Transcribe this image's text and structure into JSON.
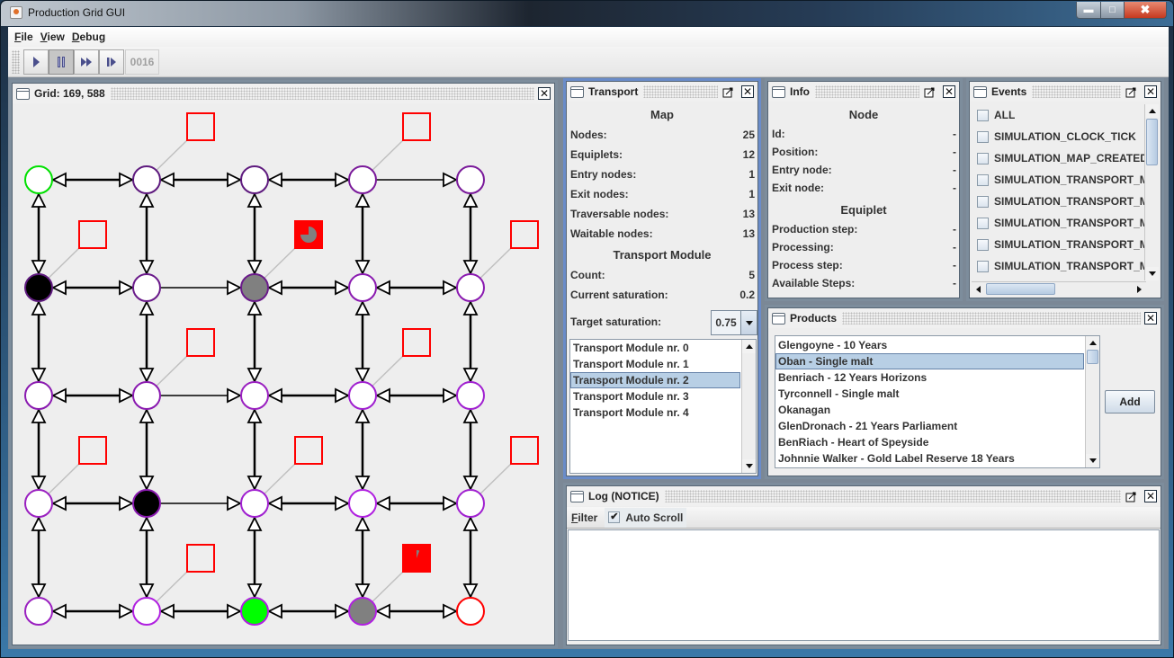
{
  "window": {
    "title": "Production Grid GUI",
    "controls": [
      "minimize",
      "maximize",
      "close"
    ]
  },
  "menubar": [
    {
      "label": "File",
      "mnemonic": "F",
      "rest": "ile"
    },
    {
      "label": "View",
      "mnemonic": "V",
      "rest": "iew"
    },
    {
      "label": "Debug",
      "mnemonic": "D",
      "rest": "ebug"
    }
  ],
  "toolbar": {
    "buttons": [
      {
        "name": "play",
        "icon": "play-icon",
        "pressed": false
      },
      {
        "name": "pause",
        "icon": "pause-icon",
        "pressed": true
      },
      {
        "name": "fast-forward",
        "icon": "fast-forward-icon",
        "pressed": false
      },
      {
        "name": "step",
        "icon": "step-icon",
        "pressed": false
      }
    ],
    "tick_counter": "0016",
    "icon_color": "#4a4f8c"
  },
  "grid_panel": {
    "title": "Grid: 169, 588",
    "colors": {
      "background": "#eeeeee",
      "edge": "#000000",
      "equiplet_border": "#ff0000",
      "equiplet_busy_fill": "#ff0000",
      "progress_fill": "#808080",
      "connector": "#c0c0c0"
    },
    "columns": 5,
    "rows": 5,
    "nodes": [
      {
        "col": 0,
        "row": 0,
        "fill": "#ffffff",
        "stroke": "#00e000",
        "role": "entry"
      },
      {
        "col": 1,
        "row": 0,
        "fill": "#ffffff",
        "stroke": "#5e1a7e"
      },
      {
        "col": 2,
        "row": 0,
        "fill": "#ffffff",
        "stroke": "#5e1a7e"
      },
      {
        "col": 3,
        "row": 0,
        "fill": "#ffffff",
        "stroke": "#7a1a9a"
      },
      {
        "col": 4,
        "row": 0,
        "fill": "#ffffff",
        "stroke": "#7a1a9a"
      },
      {
        "col": 0,
        "row": 1,
        "fill": "#000000",
        "stroke": "#5e1a7e"
      },
      {
        "col": 1,
        "row": 1,
        "fill": "#ffffff",
        "stroke": "#6a1a8a"
      },
      {
        "col": 2,
        "row": 1,
        "fill": "#808080",
        "stroke": "#6a1a8a"
      },
      {
        "col": 3,
        "row": 1,
        "fill": "#ffffff",
        "stroke": "#8a1ab0"
      },
      {
        "col": 4,
        "row": 1,
        "fill": "#ffffff",
        "stroke": "#8a1ab0"
      },
      {
        "col": 0,
        "row": 2,
        "fill": "#ffffff",
        "stroke": "#8a1ab0"
      },
      {
        "col": 1,
        "row": 2,
        "fill": "#ffffff",
        "stroke": "#8a1ab0"
      },
      {
        "col": 2,
        "row": 2,
        "fill": "#ffffff",
        "stroke": "#9a20c0"
      },
      {
        "col": 3,
        "row": 2,
        "fill": "#ffffff",
        "stroke": "#a020d0"
      },
      {
        "col": 4,
        "row": 2,
        "fill": "#ffffff",
        "stroke": "#a020d0"
      },
      {
        "col": 0,
        "row": 3,
        "fill": "#ffffff",
        "stroke": "#9a20c0"
      },
      {
        "col": 1,
        "row": 3,
        "fill": "#000000",
        "stroke": "#8a1ab0"
      },
      {
        "col": 2,
        "row": 3,
        "fill": "#ffffff",
        "stroke": "#a020d0"
      },
      {
        "col": 3,
        "row": 3,
        "fill": "#ffffff",
        "stroke": "#b020e0"
      },
      {
        "col": 4,
        "row": 3,
        "fill": "#ffffff",
        "stroke": "#a020d0"
      },
      {
        "col": 0,
        "row": 4,
        "fill": "#ffffff",
        "stroke": "#9a20c0"
      },
      {
        "col": 1,
        "row": 4,
        "fill": "#ffffff",
        "stroke": "#b020e0"
      },
      {
        "col": 2,
        "row": 4,
        "fill": "#00ff00",
        "stroke": "#b020e0"
      },
      {
        "col": 3,
        "row": 4,
        "fill": "#808080",
        "stroke": "#b020e0"
      },
      {
        "col": 4,
        "row": 4,
        "fill": "#ffffff",
        "stroke": "#ff0000",
        "role": "exit"
      }
    ],
    "edges": [
      {
        "a": [
          0,
          0
        ],
        "b": [
          1,
          0
        ],
        "dir": "both"
      },
      {
        "a": [
          1,
          0
        ],
        "b": [
          2,
          0
        ],
        "dir": "both"
      },
      {
        "a": [
          2,
          0
        ],
        "b": [
          3,
          0
        ],
        "dir": "both"
      },
      {
        "a": [
          3,
          0
        ],
        "b": [
          4,
          0
        ],
        "dir": "forward"
      },
      {
        "a": [
          0,
          1
        ],
        "b": [
          1,
          1
        ],
        "dir": "both"
      },
      {
        "a": [
          1,
          1
        ],
        "b": [
          2,
          1
        ],
        "dir": "forward"
      },
      {
        "a": [
          2,
          1
        ],
        "b": [
          3,
          1
        ],
        "dir": "both"
      },
      {
        "a": [
          3,
          1
        ],
        "b": [
          4,
          1
        ],
        "dir": "both"
      },
      {
        "a": [
          0,
          2
        ],
        "b": [
          1,
          2
        ],
        "dir": "both"
      },
      {
        "a": [
          1,
          2
        ],
        "b": [
          2,
          2
        ],
        "dir": "forward"
      },
      {
        "a": [
          2,
          2
        ],
        "b": [
          3,
          2
        ],
        "dir": "both"
      },
      {
        "a": [
          3,
          2
        ],
        "b": [
          4,
          2
        ],
        "dir": "both"
      },
      {
        "a": [
          0,
          3
        ],
        "b": [
          1,
          3
        ],
        "dir": "both"
      },
      {
        "a": [
          1,
          3
        ],
        "b": [
          2,
          3
        ],
        "dir": "forward"
      },
      {
        "a": [
          2,
          3
        ],
        "b": [
          3,
          3
        ],
        "dir": "both"
      },
      {
        "a": [
          3,
          3
        ],
        "b": [
          4,
          3
        ],
        "dir": "both"
      },
      {
        "a": [
          0,
          4
        ],
        "b": [
          1,
          4
        ],
        "dir": "both"
      },
      {
        "a": [
          1,
          4
        ],
        "b": [
          2,
          4
        ],
        "dir": "both"
      },
      {
        "a": [
          2,
          4
        ],
        "b": [
          3,
          4
        ],
        "dir": "both"
      },
      {
        "a": [
          3,
          4
        ],
        "b": [
          4,
          4
        ],
        "dir": "both"
      },
      {
        "a": [
          0,
          0
        ],
        "b": [
          0,
          1
        ],
        "dir": "both"
      },
      {
        "a": [
          1,
          0
        ],
        "b": [
          1,
          1
        ],
        "dir": "both"
      },
      {
        "a": [
          2,
          0
        ],
        "b": [
          2,
          1
        ],
        "dir": "both"
      },
      {
        "a": [
          3,
          0
        ],
        "b": [
          3,
          1
        ],
        "dir": "both"
      },
      {
        "a": [
          4,
          0
        ],
        "b": [
          4,
          1
        ],
        "dir": "both"
      },
      {
        "a": [
          0,
          1
        ],
        "b": [
          0,
          2
        ],
        "dir": "both"
      },
      {
        "a": [
          1,
          1
        ],
        "b": [
          1,
          2
        ],
        "dir": "both"
      },
      {
        "a": [
          2,
          1
        ],
        "b": [
          2,
          2
        ],
        "dir": "both"
      },
      {
        "a": [
          3,
          1
        ],
        "b": [
          3,
          2
        ],
        "dir": "both"
      },
      {
        "a": [
          4,
          1
        ],
        "b": [
          4,
          2
        ],
        "dir": "both"
      },
      {
        "a": [
          0,
          2
        ],
        "b": [
          0,
          3
        ],
        "dir": "both"
      },
      {
        "a": [
          1,
          2
        ],
        "b": [
          1,
          3
        ],
        "dir": "both"
      },
      {
        "a": [
          2,
          2
        ],
        "b": [
          2,
          3
        ],
        "dir": "both"
      },
      {
        "a": [
          3,
          2
        ],
        "b": [
          3,
          3
        ],
        "dir": "both"
      },
      {
        "a": [
          4,
          2
        ],
        "b": [
          4,
          3
        ],
        "dir": "both"
      },
      {
        "a": [
          0,
          3
        ],
        "b": [
          0,
          4
        ],
        "dir": "both"
      },
      {
        "a": [
          1,
          3
        ],
        "b": [
          1,
          4
        ],
        "dir": "both"
      },
      {
        "a": [
          2,
          3
        ],
        "b": [
          2,
          4
        ],
        "dir": "both"
      },
      {
        "a": [
          3,
          3
        ],
        "b": [
          3,
          4
        ],
        "dir": "both"
      },
      {
        "a": [
          4,
          3
        ],
        "b": [
          4,
          4
        ],
        "dir": "both"
      }
    ],
    "equiplets": [
      {
        "node": [
          1,
          0
        ],
        "busy": false,
        "progress": 0
      },
      {
        "node": [
          3,
          0
        ],
        "busy": false,
        "progress": 0
      },
      {
        "node": [
          0,
          1
        ],
        "busy": false,
        "progress": 0
      },
      {
        "node": [
          2,
          1
        ],
        "busy": true,
        "progress": 0.75
      },
      {
        "node": [
          4,
          1
        ],
        "busy": false,
        "progress": 0
      },
      {
        "node": [
          1,
          2
        ],
        "busy": false,
        "progress": 0
      },
      {
        "node": [
          3,
          2
        ],
        "busy": false,
        "progress": 0
      },
      {
        "node": [
          0,
          3
        ],
        "busy": false,
        "progress": 0
      },
      {
        "node": [
          2,
          3
        ],
        "busy": false,
        "progress": 0
      },
      {
        "node": [
          4,
          3
        ],
        "busy": false,
        "progress": 0
      },
      {
        "node": [
          1,
          4
        ],
        "busy": false,
        "progress": 0
      },
      {
        "node": [
          3,
          4
        ],
        "busy": true,
        "progress": 0.06
      }
    ]
  },
  "transport_panel": {
    "title": "Transport",
    "map_title": "Map",
    "map_stats": [
      {
        "label": "Nodes:",
        "value": "25"
      },
      {
        "label": "Equiplets:",
        "value": "12"
      },
      {
        "label": "Entry nodes:",
        "value": "1"
      },
      {
        "label": "Exit nodes:",
        "value": "1"
      },
      {
        "label": "Traversable nodes:",
        "value": "13"
      },
      {
        "label": "Waitable nodes:",
        "value": "13"
      }
    ],
    "module_title": "Transport Module",
    "module_stats": [
      {
        "label": "Count:",
        "value": "5"
      },
      {
        "label": "Current saturation:",
        "value": "0.2"
      }
    ],
    "target_saturation_label": "Target saturation:",
    "target_saturation_value": "0.75",
    "modules": [
      "Transport Module nr. 0",
      "Transport Module nr. 1",
      "Transport Module nr. 2",
      "Transport Module nr. 3",
      "Transport Module nr. 4"
    ],
    "selected_module_index": 2
  },
  "info_panel": {
    "title": "Info",
    "node_title": "Node",
    "node_fields": [
      {
        "label": "Id:",
        "value": "-"
      },
      {
        "label": "Position:",
        "value": "-"
      },
      {
        "label": "Entry node:",
        "value": "-"
      },
      {
        "label": "Exit node:",
        "value": "-"
      }
    ],
    "equiplet_title": "Equiplet",
    "equiplet_fields": [
      {
        "label": "Production step:",
        "value": "-"
      },
      {
        "label": "Processing:",
        "value": "-"
      },
      {
        "label": "Process step:",
        "value": "-"
      },
      {
        "label": "Available Steps:",
        "value": "-"
      }
    ]
  },
  "events_panel": {
    "title": "Events",
    "items": [
      {
        "label": "ALL",
        "checked": false
      },
      {
        "label": "SIMULATION_CLOCK_TICK",
        "checked": false
      },
      {
        "label": "SIMULATION_MAP_CREATED",
        "checked": false
      },
      {
        "label": "SIMULATION_TRANSPORT_MC",
        "checked": false
      },
      {
        "label": "SIMULATION_TRANSPORT_MC",
        "checked": false
      },
      {
        "label": "SIMULATION_TRANSPORT_MC",
        "checked": false
      },
      {
        "label": "SIMULATION_TRANSPORT_MC",
        "checked": false
      },
      {
        "label": "SIMULATION_TRANSPORT_MC",
        "checked": false
      }
    ]
  },
  "products_panel": {
    "title": "Products",
    "items": [
      "Glengoyne - 10 Years",
      "Oban - Single malt",
      "Benriach - 12 Years Horizons",
      "Tyrconnell - Single malt",
      "Okanagan",
      "GlenDronach - 21 Years Parliament",
      "BenRiach - Heart of Speyside",
      "Johnnie Walker - Gold Label Reserve 18 Years"
    ],
    "selected_index": 1,
    "add_label": "Add"
  },
  "log_panel": {
    "title": "Log (NOTICE)",
    "filter_label": "Filter",
    "filter_mnemonic": "F",
    "filter_rest": "ilter",
    "autoscroll_label": "Auto Scroll",
    "autoscroll_checked": true,
    "content": ""
  }
}
